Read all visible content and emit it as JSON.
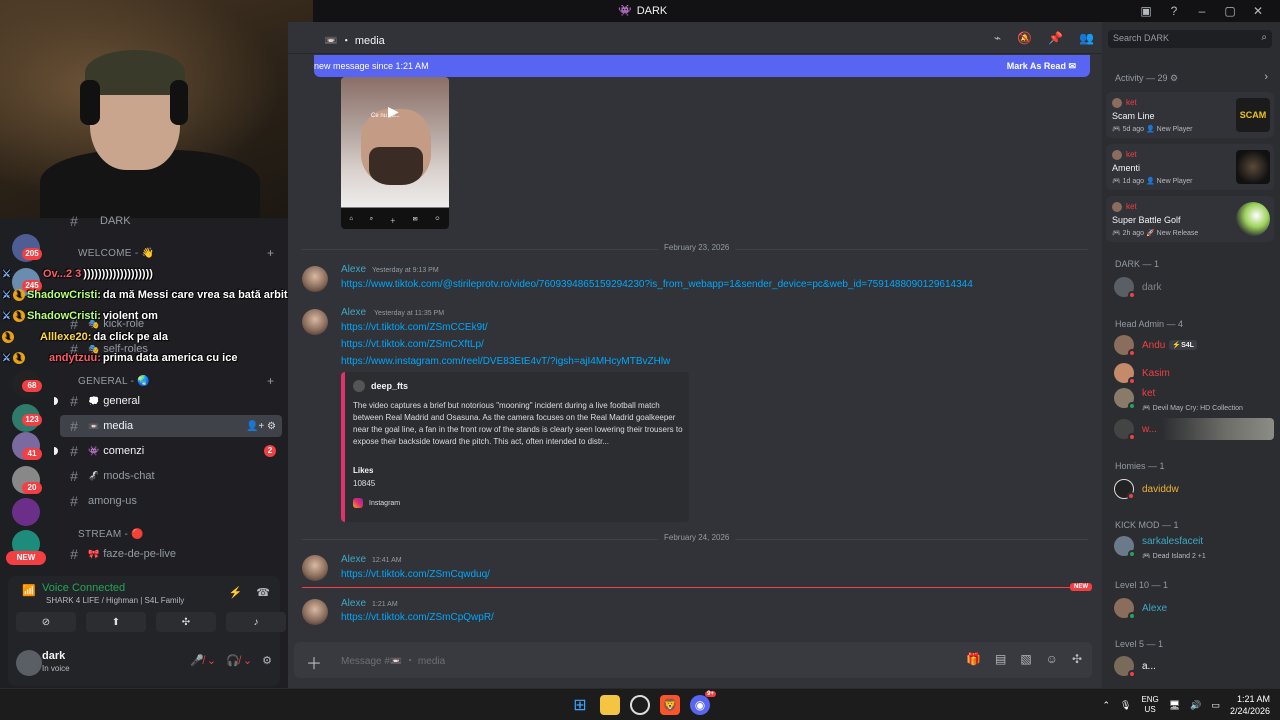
{
  "window": {
    "title": "DARK"
  },
  "servers": {
    "badges": [
      "205",
      "245",
      "123",
      "68",
      "41",
      "20"
    ],
    "new_label": "NEW"
  },
  "channel_list": {
    "top_channel": "DARK",
    "categories": [
      {
        "label": "WELCOME - 👋"
      },
      {
        "label": "GENERAL - 🌏"
      },
      {
        "label": "STREAM - 🔴"
      }
    ],
    "channels": [
      {
        "emoji": "🎭",
        "label": "kick-role"
      },
      {
        "emoji": "🎭",
        "label": "self-roles"
      },
      {
        "emoji": "💭",
        "label": "general"
      },
      {
        "emoji": "📼",
        "label": "media"
      },
      {
        "emoji": "👾",
        "label": "comenzi",
        "badge": "2"
      },
      {
        "emoji": "🦨",
        "label": "mods-chat"
      },
      {
        "emoji": "",
        "label": "among-us"
      },
      {
        "emoji": "🎀",
        "label": "faze-de-pe-live"
      }
    ]
  },
  "stream_overlay": [
    {
      "user": "Ov...2 3",
      "text": ")))))))))))))))))))",
      "color": "#ff5a6a"
    },
    {
      "user": "ShadowCristi:",
      "text": "da mă Messi care vrea sa bată arbitri",
      "color": "#b6ff7a"
    },
    {
      "user": "ShadowCristi:",
      "text": "violent om",
      "color": "#b6ff7a"
    },
    {
      "user": "Alllexe20:",
      "text": "da click pe ala",
      "color": "#ffd84a"
    },
    {
      "user": "andytzuu:",
      "text": "prima data america cu ice",
      "color": "#ff5a6a"
    }
  ],
  "voice": {
    "status": "Voice Connected",
    "channel": "SHARK 4 LIFE / Highman | S4L Family"
  },
  "user": {
    "name": "dark",
    "status": "In voice"
  },
  "header": {
    "channel": "media"
  },
  "banner": {
    "text": "new message since 1:21 AM",
    "action": "Mark As Read"
  },
  "video_thumb": {
    "caption": "Ce nu ști..."
  },
  "dividers": [
    "February 23, 2026",
    "February 24, 2026"
  ],
  "messages": [
    {
      "author": "Alexe",
      "time": "Yesterday at 9:13 PM",
      "links": [
        "https://www.tiktok.com/@stirileprotv.ro/video/7609394865159294230?is_from_webapp=1&sender_device=pc&web_id=7591488090129614344"
      ]
    },
    {
      "author": "Alexe",
      "time": "Yesterday at 11:35 PM",
      "links": [
        "https://vt.tiktok.com/ZSmCCEk9t/",
        "https://vt.tiktok.com/ZSmCXftLp/",
        "https://www.instagram.com/reel/DVE83EtE4vT/?igsh=ajI4MHcyMTBvZHlw"
      ]
    },
    {
      "author": "Alexe",
      "time": "12:41 AM",
      "links": [
        "https://vt.tiktok.com/ZSmCqwduq/"
      ]
    },
    {
      "author": "Alexe",
      "time": "1:21 AM",
      "links": [
        "https://vt.tiktok.com/ZSmCpQwpR/"
      ]
    }
  ],
  "embed": {
    "author": "deep_fts",
    "description": "The video captures a brief but notorious \"mooning\" incident during a live football match between Real Madrid and Osasuna. As the camera focuses on the Real Madrid goalkeeper near the goal line, a fan in the front row of the stands is clearly seen lowering their trousers to expose their backside toward the pitch. This act, often intended to distr...",
    "field_name": "Likes",
    "field_value": "10845",
    "footer": "Instagram",
    "accent": "#e1306c"
  },
  "new_tag": "NEW",
  "composer": {
    "placeholder": "Message #📼 ・ media"
  },
  "members": {
    "search_placeholder": "Search DARK",
    "activity_header": "Activity — 29 ⚙",
    "activities": [
      {
        "user": "ket",
        "game": "Scam Line",
        "meta": "🎮 5d ago  👤 New Player"
      },
      {
        "user": "ket",
        "game": "Amenti",
        "meta": "🎮 1d ago  👤 New Player"
      },
      {
        "user": "ket",
        "game": "Super Battle Golf",
        "meta": "🎮 2h ago  🚀 New Release"
      }
    ],
    "groups": [
      {
        "label": "DARK — 1"
      },
      {
        "label": "Head Admin — 4"
      },
      {
        "label": "Homies — 1"
      },
      {
        "label": "KICK MOD — 1"
      },
      {
        "label": "Level 10 — 1"
      },
      {
        "label": "Level 5 — 1"
      }
    ],
    "list": [
      {
        "name": "dark",
        "color": "#80848e"
      },
      {
        "name": "Andu",
        "color": "#f23f43",
        "tag": "⚡S4L"
      },
      {
        "name": "Kasim",
        "color": "#f23f43"
      },
      {
        "name": "ket",
        "color": "#f23f43",
        "sub": "🎮 Devil May Cry: HD Collection"
      },
      {
        "name": "w...",
        "color": "#f23f43"
      },
      {
        "name": "daviddw",
        "color": "#f0b232"
      },
      {
        "name": "sarkalesfaceit",
        "color": "#3fa8c4",
        "sub": "🎮 Dead Island 2 +1"
      },
      {
        "name": "Alexe",
        "color": "#3fa8c4"
      },
      {
        "name": "a...",
        "color": "#f2f3f5"
      }
    ]
  },
  "taskbar": {
    "lang1": "ENG",
    "lang2": "US",
    "time": "1:21 AM",
    "date": "2/24/2026",
    "badge": "9+"
  }
}
